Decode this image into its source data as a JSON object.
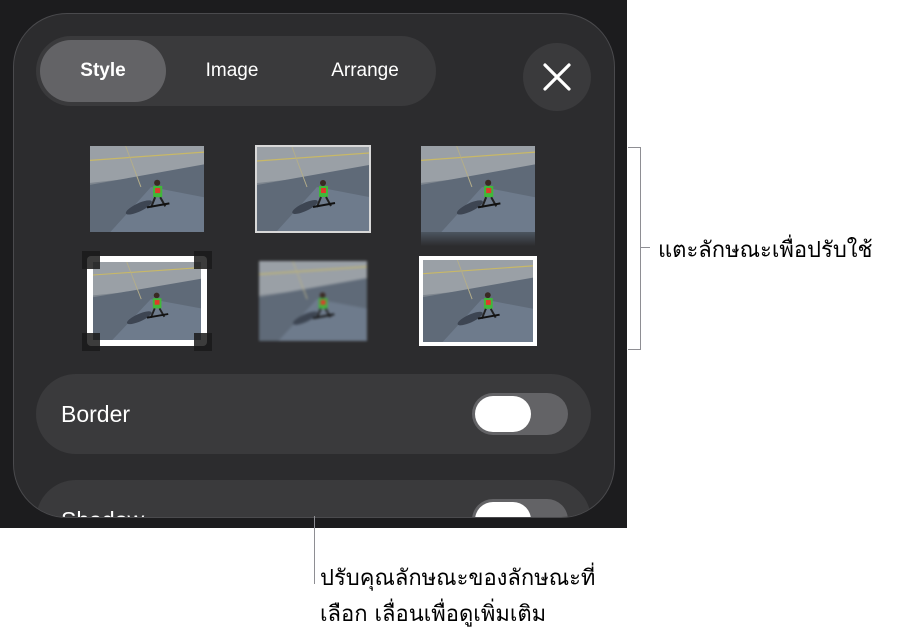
{
  "tabs": [
    {
      "label": "Style",
      "active": true
    },
    {
      "label": "Image",
      "active": false
    },
    {
      "label": "Arrange",
      "active": false
    }
  ],
  "close_icon": "close-icon",
  "style_presets": [
    "plain-style",
    "thin-border-style",
    "reflection-style",
    "photo-corners-style",
    "soft-edge-style",
    "thick-border-style"
  ],
  "options": {
    "border": {
      "label": "Border",
      "on": false
    },
    "shadow": {
      "label": "Shadow",
      "on": false
    }
  },
  "callouts": {
    "styles": "แตะลักษณะเพื่อปรับใช้",
    "options_line1": "ปรับคุณลักษณะของลักษณะที่",
    "options_line2": "เลือก เลื่อนเพื่อดูเพิ่มเติม"
  },
  "colors": {
    "background": "#1c1c1e",
    "panel": "#2c2c2e",
    "control": "#3a3a3c",
    "active_tab": "#636366"
  }
}
